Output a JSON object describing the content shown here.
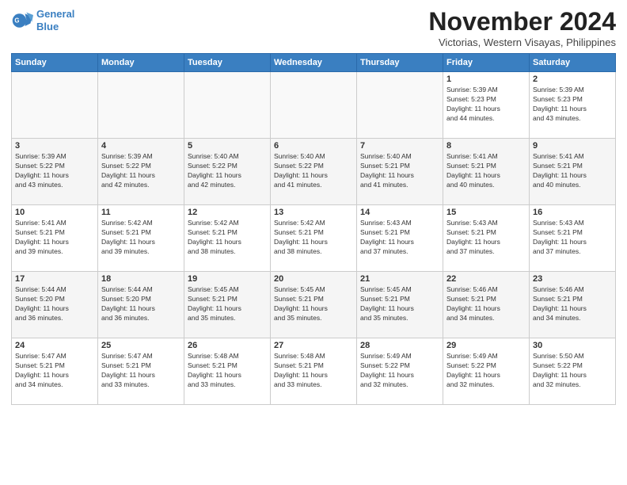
{
  "header": {
    "logo_line1": "General",
    "logo_line2": "Blue",
    "month_title": "November 2024",
    "location": "Victorias, Western Visayas, Philippines"
  },
  "weekdays": [
    "Sunday",
    "Monday",
    "Tuesday",
    "Wednesday",
    "Thursday",
    "Friday",
    "Saturday"
  ],
  "weeks": [
    [
      {
        "day": "",
        "info": ""
      },
      {
        "day": "",
        "info": ""
      },
      {
        "day": "",
        "info": ""
      },
      {
        "day": "",
        "info": ""
      },
      {
        "day": "",
        "info": ""
      },
      {
        "day": "1",
        "info": "Sunrise: 5:39 AM\nSunset: 5:23 PM\nDaylight: 11 hours\nand 44 minutes."
      },
      {
        "day": "2",
        "info": "Sunrise: 5:39 AM\nSunset: 5:23 PM\nDaylight: 11 hours\nand 43 minutes."
      }
    ],
    [
      {
        "day": "3",
        "info": "Sunrise: 5:39 AM\nSunset: 5:22 PM\nDaylight: 11 hours\nand 43 minutes."
      },
      {
        "day": "4",
        "info": "Sunrise: 5:39 AM\nSunset: 5:22 PM\nDaylight: 11 hours\nand 42 minutes."
      },
      {
        "day": "5",
        "info": "Sunrise: 5:40 AM\nSunset: 5:22 PM\nDaylight: 11 hours\nand 42 minutes."
      },
      {
        "day": "6",
        "info": "Sunrise: 5:40 AM\nSunset: 5:22 PM\nDaylight: 11 hours\nand 41 minutes."
      },
      {
        "day": "7",
        "info": "Sunrise: 5:40 AM\nSunset: 5:21 PM\nDaylight: 11 hours\nand 41 minutes."
      },
      {
        "day": "8",
        "info": "Sunrise: 5:41 AM\nSunset: 5:21 PM\nDaylight: 11 hours\nand 40 minutes."
      },
      {
        "day": "9",
        "info": "Sunrise: 5:41 AM\nSunset: 5:21 PM\nDaylight: 11 hours\nand 40 minutes."
      }
    ],
    [
      {
        "day": "10",
        "info": "Sunrise: 5:41 AM\nSunset: 5:21 PM\nDaylight: 11 hours\nand 39 minutes."
      },
      {
        "day": "11",
        "info": "Sunrise: 5:42 AM\nSunset: 5:21 PM\nDaylight: 11 hours\nand 39 minutes."
      },
      {
        "day": "12",
        "info": "Sunrise: 5:42 AM\nSunset: 5:21 PM\nDaylight: 11 hours\nand 38 minutes."
      },
      {
        "day": "13",
        "info": "Sunrise: 5:42 AM\nSunset: 5:21 PM\nDaylight: 11 hours\nand 38 minutes."
      },
      {
        "day": "14",
        "info": "Sunrise: 5:43 AM\nSunset: 5:21 PM\nDaylight: 11 hours\nand 37 minutes."
      },
      {
        "day": "15",
        "info": "Sunrise: 5:43 AM\nSunset: 5:21 PM\nDaylight: 11 hours\nand 37 minutes."
      },
      {
        "day": "16",
        "info": "Sunrise: 5:43 AM\nSunset: 5:21 PM\nDaylight: 11 hours\nand 37 minutes."
      }
    ],
    [
      {
        "day": "17",
        "info": "Sunrise: 5:44 AM\nSunset: 5:20 PM\nDaylight: 11 hours\nand 36 minutes."
      },
      {
        "day": "18",
        "info": "Sunrise: 5:44 AM\nSunset: 5:20 PM\nDaylight: 11 hours\nand 36 minutes."
      },
      {
        "day": "19",
        "info": "Sunrise: 5:45 AM\nSunset: 5:21 PM\nDaylight: 11 hours\nand 35 minutes."
      },
      {
        "day": "20",
        "info": "Sunrise: 5:45 AM\nSunset: 5:21 PM\nDaylight: 11 hours\nand 35 minutes."
      },
      {
        "day": "21",
        "info": "Sunrise: 5:45 AM\nSunset: 5:21 PM\nDaylight: 11 hours\nand 35 minutes."
      },
      {
        "day": "22",
        "info": "Sunrise: 5:46 AM\nSunset: 5:21 PM\nDaylight: 11 hours\nand 34 minutes."
      },
      {
        "day": "23",
        "info": "Sunrise: 5:46 AM\nSunset: 5:21 PM\nDaylight: 11 hours\nand 34 minutes."
      }
    ],
    [
      {
        "day": "24",
        "info": "Sunrise: 5:47 AM\nSunset: 5:21 PM\nDaylight: 11 hours\nand 34 minutes."
      },
      {
        "day": "25",
        "info": "Sunrise: 5:47 AM\nSunset: 5:21 PM\nDaylight: 11 hours\nand 33 minutes."
      },
      {
        "day": "26",
        "info": "Sunrise: 5:48 AM\nSunset: 5:21 PM\nDaylight: 11 hours\nand 33 minutes."
      },
      {
        "day": "27",
        "info": "Sunrise: 5:48 AM\nSunset: 5:21 PM\nDaylight: 11 hours\nand 33 minutes."
      },
      {
        "day": "28",
        "info": "Sunrise: 5:49 AM\nSunset: 5:22 PM\nDaylight: 11 hours\nand 32 minutes."
      },
      {
        "day": "29",
        "info": "Sunrise: 5:49 AM\nSunset: 5:22 PM\nDaylight: 11 hours\nand 32 minutes."
      },
      {
        "day": "30",
        "info": "Sunrise: 5:50 AM\nSunset: 5:22 PM\nDaylight: 11 hours\nand 32 minutes."
      }
    ]
  ]
}
